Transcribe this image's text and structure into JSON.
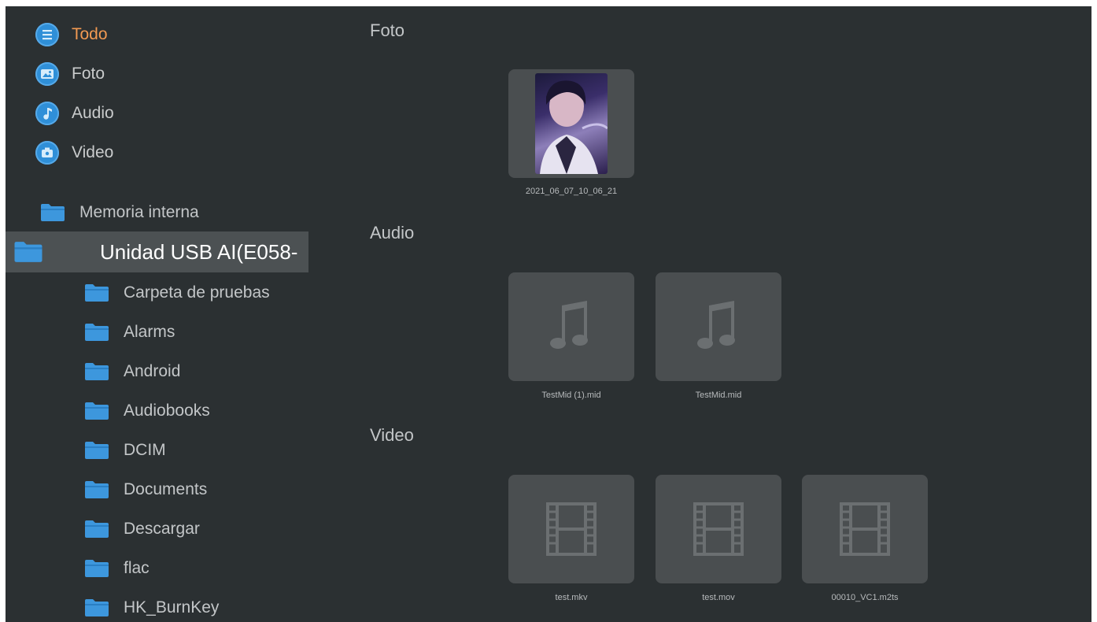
{
  "categories": [
    {
      "label": "Todo",
      "icon": "list-icon",
      "active": true
    },
    {
      "label": "Foto",
      "icon": "photo-icon",
      "active": false
    },
    {
      "label": "Audio",
      "icon": "music-note-icon",
      "active": false
    },
    {
      "label": "Video",
      "icon": "video-camera-icon",
      "active": false
    }
  ],
  "storage": {
    "internal": "Memoria interna",
    "usb": "Unidad USB AI(E058-"
  },
  "folders": [
    "Carpeta de pruebas",
    "Alarms",
    "Android",
    "Audiobooks",
    "DCIM",
    "Documents",
    "Descargar",
    "flac",
    "HK_BurnKey"
  ],
  "sections": {
    "photo": {
      "title": "Foto",
      "items": [
        {
          "caption": "2021_06_07_10_06_21",
          "icon": "photo-thumbnail"
        }
      ]
    },
    "audio": {
      "title": "Audio",
      "items": [
        {
          "caption": "TestMid (1).mid",
          "icon": "music-note-icon"
        },
        {
          "caption": "TestMid.mid",
          "icon": "music-note-icon"
        }
      ]
    },
    "video": {
      "title": "Video",
      "items": [
        {
          "caption": "test.mkv",
          "icon": "film-icon"
        },
        {
          "caption": "test.mov",
          "icon": "film-icon"
        },
        {
          "caption": "00010_VC1.m2ts",
          "icon": "film-icon"
        }
      ]
    }
  },
  "colors": {
    "background": "#2b3032",
    "active_category": "#f29a52",
    "selected_row": "#4c5153",
    "folder": "#3d97dd",
    "tile": "#4a4e50",
    "tile_icon": "#6b6f71"
  }
}
